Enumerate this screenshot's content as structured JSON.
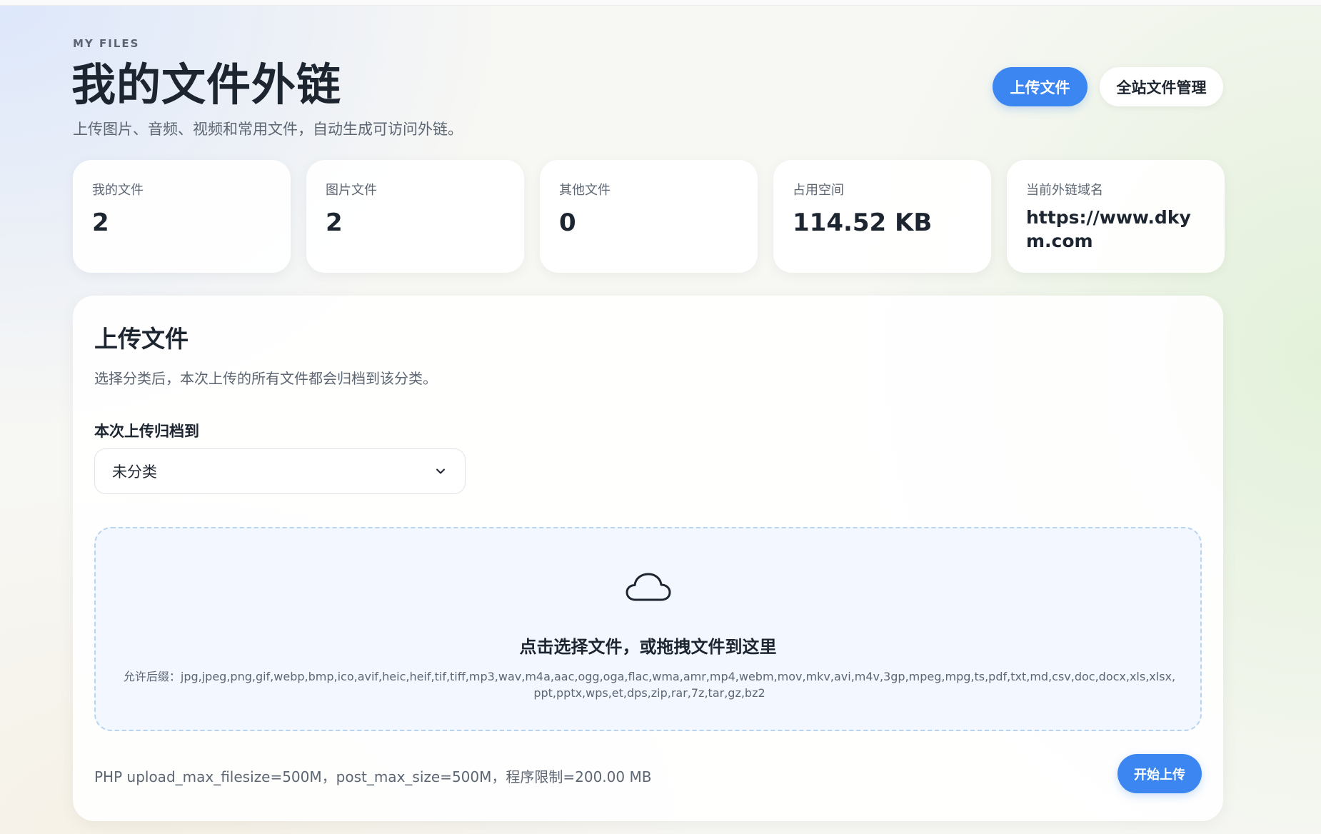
{
  "header": {
    "eyebrow": "MY FILES",
    "title": "我的文件外链",
    "subtitle": "上传图片、音频、视频和常用文件，自动生成可访问外链。",
    "upload_button": "上传文件",
    "manage_button": "全站文件管理"
  },
  "stats": [
    {
      "label": "我的文件",
      "value": "2"
    },
    {
      "label": "图片文件",
      "value": "2"
    },
    {
      "label": "其他文件",
      "value": "0"
    },
    {
      "label": "占用空间",
      "value": "114.52 KB"
    },
    {
      "label": "当前外链域名",
      "value": "https://www.dkym.com"
    }
  ],
  "upload": {
    "title": "上传文件",
    "description": "选择分类后，本次上传的所有文件都会归档到该分类。",
    "category_label": "本次上传归档到",
    "category_selected": "未分类",
    "dropzone_title": "点击选择文件，或拖拽文件到这里",
    "dropzone_hint": "允许后缀：jpg,jpeg,png,gif,webp,bmp,ico,avif,heic,heif,tif,tiff,mp3,wav,m4a,aac,ogg,oga,flac,wma,amr,mp4,webm,mov,mkv,avi,m4v,3gp,mpeg,mpg,ts,pdf,txt,md,csv,doc,docx,xls,xlsx,ppt,pptx,wps,et,dps,zip,rar,7z,tar,gz,bz2",
    "limits": "PHP upload_max_filesize=500M，post_max_size=500M，程序限制=200.00 MB",
    "start_button": "开始上传"
  },
  "icons": {
    "dropzone": "cloud-icon",
    "select": "chevron-down-icon"
  },
  "colors": {
    "accent": "#3b86f1",
    "text_primary": "#1d2530",
    "text_secondary": "#5d6673",
    "dropzone_border": "#b9d4ee",
    "dropzone_bg": "#f3f7ff"
  }
}
